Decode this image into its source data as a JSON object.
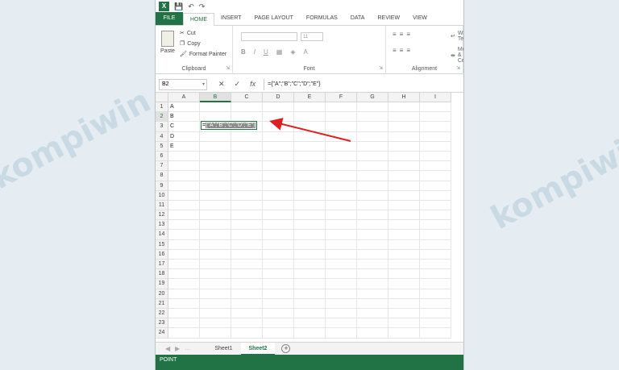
{
  "titlebar": {
    "app_icon": "X",
    "undo_icon": "undo-icon",
    "redo_icon": "redo-icon"
  },
  "tabs": [
    "FILE",
    "HOME",
    "INSERT",
    "PAGE LAYOUT",
    "FORMULAS",
    "DATA",
    "REVIEW",
    "VIEW"
  ],
  "ribbon": {
    "paste": "Paste",
    "cut": "Cut",
    "copy": "Copy",
    "format_painter": "Format Painter",
    "clipboard": "Clipboard",
    "font_size": "11",
    "bold": "B",
    "italic": "I",
    "underline": "U",
    "font": "Font",
    "wrap_text": "Wrap Text",
    "merge_center": "Merge & Center",
    "alignment": "Alignment"
  },
  "formula_bar": {
    "name_box": "B2",
    "cancel": "✕",
    "enter": "✓",
    "fx": "fx",
    "formula": "={\"A\";\"B\";\"C\";\"D\";\"E\"}"
  },
  "columns": [
    "A",
    "B",
    "C",
    "D",
    "E",
    "F",
    "G",
    "H",
    "I"
  ],
  "rows": [
    "1",
    "2",
    "3",
    "4",
    "5",
    "6",
    "7",
    "8",
    "9",
    "10",
    "11",
    "12",
    "13",
    "14",
    "15",
    "16",
    "17",
    "18",
    "19",
    "20",
    "21",
    "22",
    "23",
    "24"
  ],
  "cells_a": [
    "A",
    "B",
    "C",
    "D",
    "E"
  ],
  "cell_edit": {
    "prefix": "=",
    "body": "{\"A\";\"B\";\"C\";\"D\";\"E\"}"
  },
  "sheets": [
    "Sheet1",
    "Sheet2"
  ],
  "add_sheet": "+",
  "status": "POINT",
  "watermark": "kompiwin",
  "colors": {
    "excel_green": "#217346",
    "arrow_red": "#e02020"
  }
}
